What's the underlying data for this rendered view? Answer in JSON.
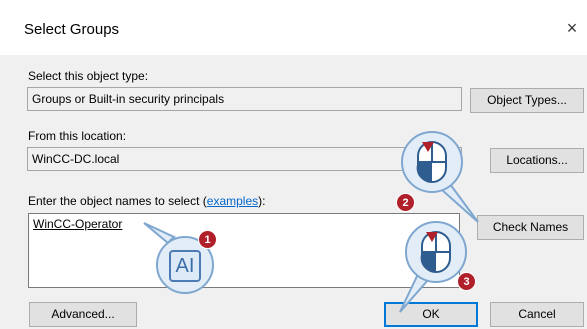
{
  "dialog": {
    "title": "Select Groups",
    "close_glyph": "×",
    "object_type_label": "Select this object type:",
    "object_type_value": "Groups or Built-in security principals",
    "object_types_button": "Object Types...",
    "location_label": "From this location:",
    "location_value": "WinCC-DC.local",
    "locations_button": "Locations...",
    "names_label_prefix": "Enter the object names to select (",
    "names_label_link": "examples",
    "names_label_suffix": "):",
    "names_value": "WinCC-Operator",
    "check_names_button": "Check Names",
    "advanced_button": "Advanced...",
    "ok_button": "OK",
    "cancel_button": "Cancel"
  },
  "callouts": {
    "step1": "1",
    "step2": "2",
    "step3": "3",
    "text_cursor_glyph": "AI"
  },
  "colors": {
    "accent": "#0078d7",
    "badge": "#b0202a",
    "callout_fill": "#e2edf8"
  }
}
